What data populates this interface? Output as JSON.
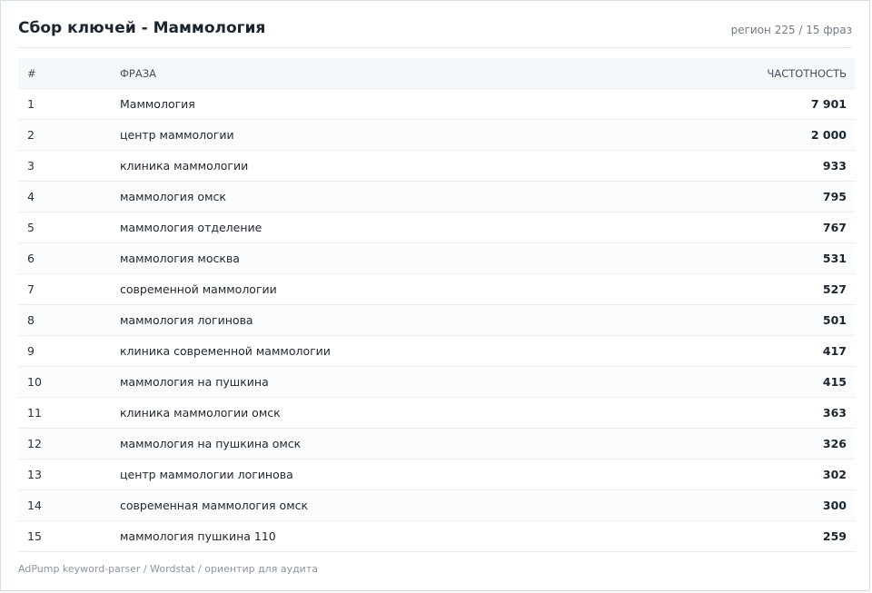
{
  "header": {
    "title": "Сбор ключей - Маммология",
    "meta": "регион 225 / 15 фраз"
  },
  "table": {
    "columns": {
      "num": "#",
      "phrase": "ФРАЗА",
      "frequency": "ЧАСТОТНОСТЬ"
    },
    "rows": [
      {
        "num": "1",
        "phrase": "Маммология",
        "frequency": "7 901"
      },
      {
        "num": "2",
        "phrase": "центр маммологии",
        "frequency": "2 000"
      },
      {
        "num": "3",
        "phrase": "клиника маммологии",
        "frequency": "933"
      },
      {
        "num": "4",
        "phrase": "маммология омск",
        "frequency": "795"
      },
      {
        "num": "5",
        "phrase": "маммология отделение",
        "frequency": "767"
      },
      {
        "num": "6",
        "phrase": "маммология москва",
        "frequency": "531"
      },
      {
        "num": "7",
        "phrase": "современной маммологии",
        "frequency": "527"
      },
      {
        "num": "8",
        "phrase": "маммология логинова",
        "frequency": "501"
      },
      {
        "num": "9",
        "phrase": "клиника современной маммологии",
        "frequency": "417"
      },
      {
        "num": "10",
        "phrase": "маммология на пушкина",
        "frequency": "415"
      },
      {
        "num": "11",
        "phrase": "клиника маммологии омск",
        "frequency": "363"
      },
      {
        "num": "12",
        "phrase": "маммология на пушкина омск",
        "frequency": "326"
      },
      {
        "num": "13",
        "phrase": "центр маммологии логинова",
        "frequency": "302"
      },
      {
        "num": "14",
        "phrase": "современная маммология омск",
        "frequency": "300"
      },
      {
        "num": "15",
        "phrase": "маммология пушкина 110",
        "frequency": "259"
      }
    ]
  },
  "footer": {
    "text": "AdPump keyword-parser / Wordstat / ориентир для аудита"
  }
}
